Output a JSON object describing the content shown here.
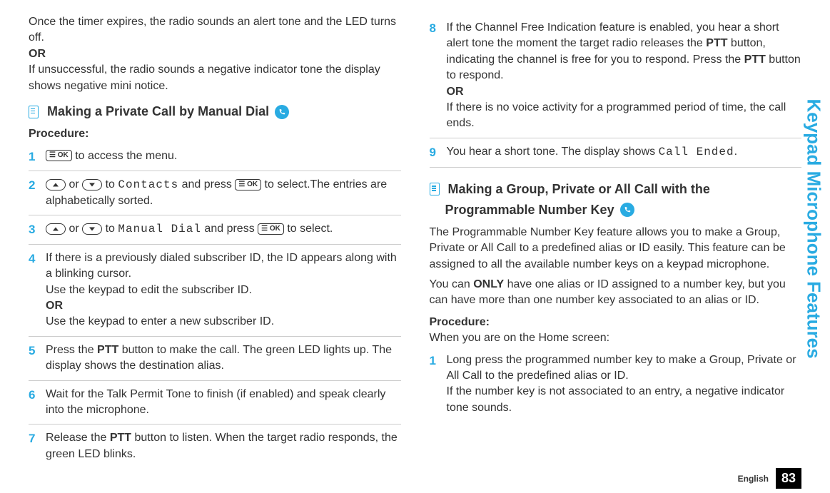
{
  "sidetab": "Keypad Microphone Features",
  "footer": {
    "lang": "English",
    "page": "83"
  },
  "leftCol": {
    "intro": {
      "line1": "Once the timer expires, the radio sounds an alert tone and the LED turns off.",
      "or": "OR",
      "line2": "If unsuccessful, the radio sounds a negative indicator tone the display shows negative mini notice."
    },
    "heading1": "Making a Private Call by Manual Dial",
    "procLabel": "Procedure:",
    "steps": {
      "s1_a": " to access the menu.",
      "s2_a": " or ",
      "s2_b": " to ",
      "s2_contacts": "Contacts",
      "s2_c": " and press ",
      "s2_d": " to select.The entries are alphabetically sorted.",
      "s3_a": " or ",
      "s3_b": " to ",
      "s3_manual": "Manual Dial",
      "s3_c": " and press ",
      "s3_d": " to select.",
      "s4_a": "If there is a previously dialed subscriber ID, the ID appears along with a blinking cursor.",
      "s4_b": "Use the keypad to edit the subscriber ID.",
      "s4_or": "OR",
      "s4_c": "Use the keypad to enter a new subscriber ID.",
      "s5": "Press the ",
      "s5_ptt": "PTT",
      "s5_b": " button to make the call. The green LED lights up. The display shows the destination alias.",
      "s6": "Wait for the Talk Permit Tone to finish (if enabled) and speak clearly into the microphone.",
      "s7_a": "Release the ",
      "s7_ptt": "PTT",
      "s7_b": " button to listen. When the target radio responds, the green LED blinks."
    }
  },
  "rightCol": {
    "steps": {
      "s8_a": "If the Channel Free Indication feature is enabled, you hear a short alert tone the moment the target radio releases the ",
      "s8_ptt1": "PTT",
      "s8_b": " button, indicating the channel is free for you to respond. Press the ",
      "s8_ptt2": "PTT",
      "s8_c": " button to respond.",
      "s8_or": "OR",
      "s8_d": "If there is no voice activity for a programmed period of time, the call ends.",
      "s9_a": "You hear a short tone. The display shows ",
      "s9_callended": "Call Ended",
      "s9_b": "."
    },
    "heading2a": "Making a Group, Private or All Call with the",
    "heading2b": "Programmable Number Key",
    "para1": "The Programmable Number Key feature allows you to make a Group, Private or All Call to a predefined alias or ID easily. This feature can be assigned to all the available number keys on a keypad microphone.",
    "para2_a": "You can ",
    "para2_only": "ONLY",
    "para2_b": " have one alias or ID assigned to a number key, but you can have more than one number key associated to an alias or ID.",
    "procLabel": "Procedure:",
    "procNote": "When you are on the Home screen:",
    "bsteps": {
      "s1_a": "Long press the programmed number key to make a Group, Private or All Call to the predefined alias or ID.",
      "s1_b": "If the number key is not associated to an entry, a negative indicator tone sounds."
    }
  }
}
